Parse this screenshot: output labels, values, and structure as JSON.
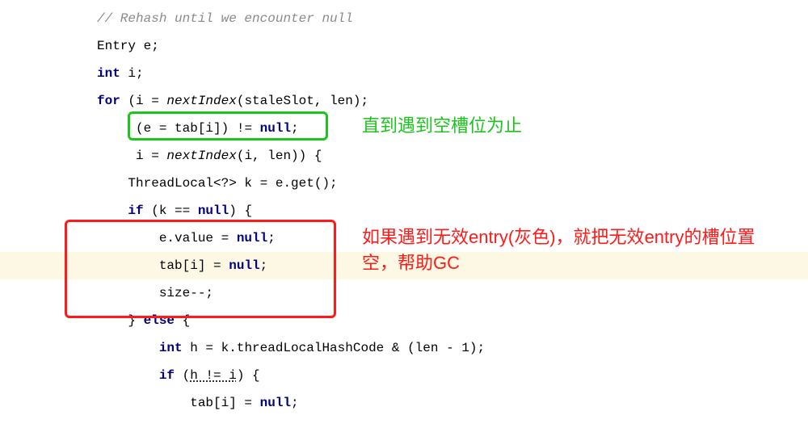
{
  "code": {
    "l1": "// Rehash until we encounter null",
    "l2_a": "Entry e;",
    "l3_a": "int",
    "l3_b": " i;",
    "l4_a": "for",
    "l4_b": " (i = ",
    "l4_fn": "nextIndex",
    "l4_c": "(staleSlot, len);",
    "l5_a": "(e = tab[i]) != ",
    "l5_n": "null",
    "l5_b": ";",
    "l6_a": "i = ",
    "l6_fn": "nextIndex",
    "l6_b": "(i, len)) {",
    "l7": "ThreadLocal<?> k = e.get();",
    "l8_a": "if",
    "l8_b": " (k == ",
    "l8_n": "null",
    "l8_c": ") {",
    "l9_a": "e.value = ",
    "l9_n": "null",
    "l9_b": ";",
    "l10_a": "tab[i] = ",
    "l10_n": "null",
    "l10_b": ";",
    "l11": "size--;",
    "l12_a": "} ",
    "l12_e": "else",
    "l12_b": " {",
    "l13_a": "int",
    "l13_b": " h = k.threadLocalHashCode & (len - ",
    "l13_c": "1",
    "l13_d": ");",
    "l14_a": "if",
    "l14_b": " (",
    "l14_u": "h != i",
    "l14_c": ") {",
    "l15_a": "tab[i] = ",
    "l15_n": "null",
    "l15_b": ";"
  },
  "annotations": {
    "green": "直到遇到空槽位为止",
    "red": "如果遇到无效entry(灰色)，就把无效entry的槽位置空，帮助GC"
  }
}
